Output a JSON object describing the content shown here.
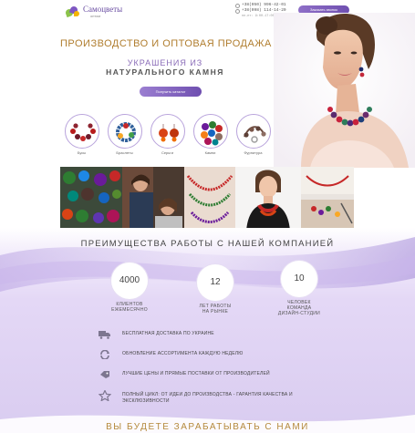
{
  "header": {
    "logo_title": "Самоцветы",
    "logo_subtitle": "оптом",
    "phone_1": "+38(050) 996-42-01",
    "phone_2": "+38(098) 114-14-20",
    "hours": "пн-пт: 9:00-17:00",
    "callback_label": "Заказать звонок"
  },
  "hero": {
    "title": "ПРОИЗВОДСТВО И ОПТОВАЯ ПРОДАЖА",
    "subtitle_line1": "УКРАШЕНИЯ ИЗ",
    "subtitle_line2": "НАТУРАЛЬНОГО КАМНЯ",
    "catalog_button": "Получить каталог"
  },
  "categories": [
    {
      "label": "Бусы",
      "icon": "beads-necklace-icon"
    },
    {
      "label": "Браслеты",
      "icon": "bracelet-icon"
    },
    {
      "label": "Серьги",
      "icon": "earrings-icon"
    },
    {
      "label": "Камни",
      "icon": "stones-icon"
    },
    {
      "label": "Фурнитура",
      "icon": "findings-icon"
    }
  ],
  "advantages": {
    "title": "ПРЕИМУЩЕСТВА РАБОТЫ С НАШЕЙ КОМПАНИЕЙ",
    "stats": [
      {
        "value": "4000",
        "line1": "КЛИЕНТОВ",
        "line2": "ЕЖЕМЕСЯЧНО",
        "line3": ""
      },
      {
        "value": "12",
        "line1": "ЛЕТ РАБОТЫ",
        "line2": "НА РЫНКЕ",
        "line3": ""
      },
      {
        "value": "10",
        "line1": "ЧЕЛОВЕК",
        "line2": "КОМАНДА",
        "line3": "ДИЗАЙН-СТУДИИ"
      }
    ],
    "features": [
      {
        "text": "БЕСПЛАТНАЯ ДОСТАВКА ПО УКРАИНЕ",
        "text2": "",
        "icon": "truck-icon"
      },
      {
        "text": "ОБНОВЛЕНИЕ АССОРТИМЕНТА КАЖДУЮ НЕДЕЛЮ",
        "text2": "",
        "icon": "refresh-icon"
      },
      {
        "text": "ЛУЧШИЕ ЦЕНЫ И ПРЯМЫЕ ПОСТАВКИ ОТ ПРОИЗВОДИТЕЛЕЙ",
        "text2": "",
        "icon": "price-tag-icon"
      },
      {
        "text": "ПОЛНЫЙ ЦИКЛ: ОТ ИДЕИ ДО ПРОИЗВОДСТВА - ГАРАНТИЯ КАЧЕСТВА И",
        "text2": "ЭКСКЛЮЗИВНОСТИ",
        "icon": "star-icon"
      }
    ]
  },
  "bottom_title": "ВЫ БУДЕТЕ ЗАРАБАТЫВАТЬ С НАМИ",
  "colors": {
    "accent_purple": "#6f4fb0",
    "gold_title": "#b07d2e",
    "lavender_bg": "#d9ccf0"
  }
}
